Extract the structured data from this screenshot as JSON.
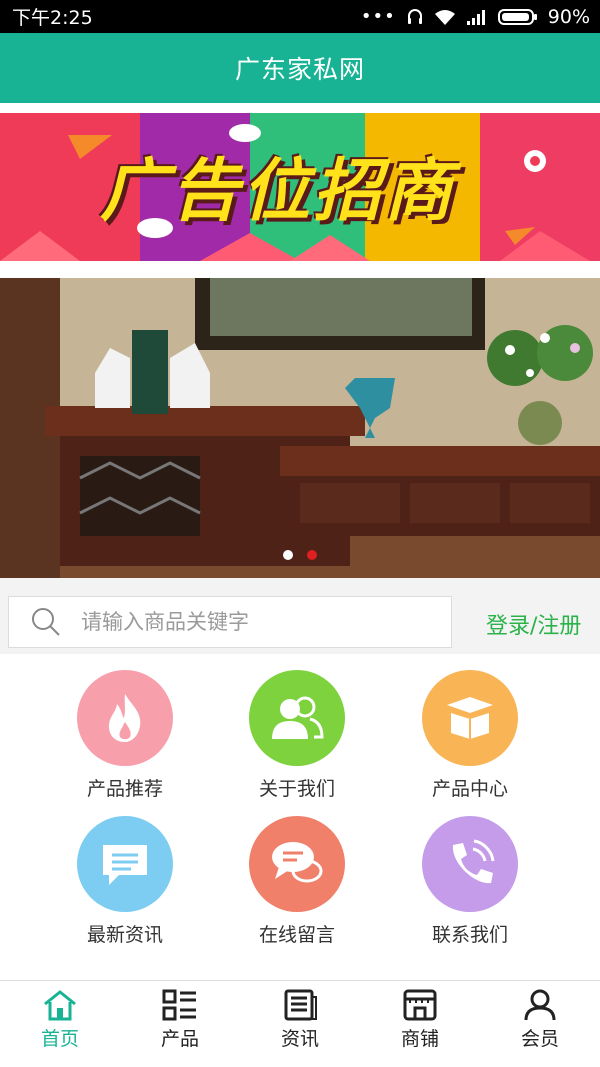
{
  "status_bar": {
    "time": "下午2:25",
    "battery": "90%"
  },
  "header": {
    "title": "广东家私网"
  },
  "ad_banner": {
    "text": "广告位招商"
  },
  "carousel": {
    "dots": 2,
    "active_index": 1
  },
  "search": {
    "placeholder": "请输入商品关键字",
    "login_label": "登录/注册"
  },
  "menu": {
    "items": [
      {
        "label": "产品推荐",
        "icon": "flame-icon",
        "color": "#f7a0ac"
      },
      {
        "label": "关于我们",
        "icon": "users-icon",
        "color": "#7dd23e"
      },
      {
        "label": "产品中心",
        "icon": "box-icon",
        "color": "#f9b555"
      },
      {
        "label": "最新资讯",
        "icon": "message-icon",
        "color": "#7ccdf1"
      },
      {
        "label": "在线留言",
        "icon": "chat-icon",
        "color": "#f0806a"
      },
      {
        "label": "联系我们",
        "icon": "phone-icon",
        "color": "#c59ce9"
      }
    ]
  },
  "tabs": [
    {
      "label": "首页",
      "icon": "home-icon",
      "active": true
    },
    {
      "label": "产品",
      "icon": "list-icon",
      "active": false
    },
    {
      "label": "资讯",
      "icon": "news-icon",
      "active": false
    },
    {
      "label": "商铺",
      "icon": "shop-icon",
      "active": false
    },
    {
      "label": "会员",
      "icon": "user-icon",
      "active": false
    }
  ],
  "colors": {
    "primary": "#17b394",
    "login": "#2bb34a",
    "active_dot": "#e02020"
  }
}
